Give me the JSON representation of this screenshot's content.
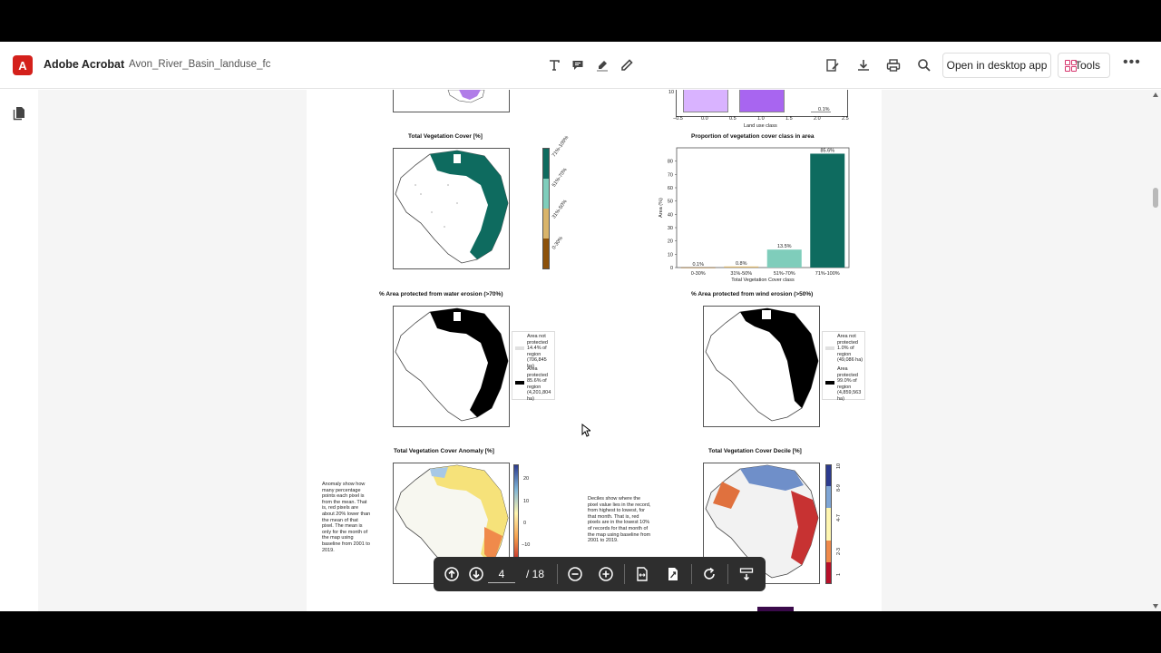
{
  "app": {
    "name": "Adobe Acrobat",
    "logo_letter": "A",
    "file_name": "Avon_River_Basin_landuse_fc",
    "open_button": "Open in desktop app",
    "tools_button": "Tools",
    "more_glyph": "•••",
    "accent": "#d4201b"
  },
  "toolbar_icons": [
    "text-icon",
    "comment-icon",
    "highlight-icon",
    "draw-icon",
    "sign-icon",
    "download-icon",
    "print-icon",
    "search-icon"
  ],
  "document": {
    "top_axis": {
      "ticks": [
        "−0.5",
        "0.0",
        "0.5",
        "1.0",
        "1.5",
        "2.0",
        "2.5"
      ],
      "xlabel": "Land use class",
      "ytick": "10",
      "bar_label": "0.1%"
    },
    "veg_cover": {
      "title": "Total Vegetation Cover [%]",
      "legend": [
        "71%-100%",
        "51%-70%",
        "31%-50%",
        "0-30%"
      ],
      "legend_colors": [
        "#0e6b5f",
        "#7fcdbb",
        "#d9b46a",
        "#8c510a"
      ]
    },
    "proportion_chart": {
      "title": "Proportion of vegetation cover class in area",
      "ylabel": "Area (%)",
      "xlabel": "Total Vegetation Cover class"
    },
    "water_erosion": {
      "title": "% Area protected from water erosion (>70%)",
      "legend_not": "Area not protected 14.4% of region (706,845 ha)",
      "legend_yes": "Area protected 85.6% of region (4,201,804 ha)"
    },
    "wind_erosion": {
      "title": "% Area protected from wind erosion (>50%)",
      "legend_not": "Area not protected 1.0% of region (49,086 ha)",
      "legend_yes": "Area protected 99.0% of region (4,859,563 ha)"
    },
    "anomaly": {
      "title": "Total Vegetation Cover Anomaly [%]",
      "note": "Anomaly show how many percentage points each pixel is from the mean. That is, red pixels are about 20% lower than the mean of that pixel. The mean is only for the month of the map using baseline from 2001 to 2019.",
      "cbar_ticks": [
        "20",
        "10",
        "0",
        "−10"
      ]
    },
    "decile": {
      "title": "Total Vegetation Cover Decile [%]",
      "note": "Deciles show where the pixel value lies in the record, from highest to lowest, for that month. That is, red pixels are in the lowest 10% of records for that month of the map using baseline from 2001 to 2019.",
      "cbar_ticks": [
        "10",
        "8-9",
        "4-7",
        "2-3",
        "1"
      ]
    }
  },
  "chart_data": {
    "type": "bar",
    "title": "Proportion of vegetation cover class in area",
    "xlabel": "Total Vegetation Cover class",
    "ylabel": "Area (%)",
    "categories": [
      "0-30%",
      "31%-50%",
      "51%-70%",
      "71%-100%"
    ],
    "values": [
      0.1,
      0.8,
      13.5,
      85.6
    ],
    "labels": [
      "0.1%",
      "0.8%",
      "13.5%",
      "85.6%"
    ],
    "colors": [
      "#8c510a",
      "#d9b46a",
      "#7fcdbb",
      "#0e6b5f"
    ],
    "ylim": [
      0,
      90
    ],
    "yticks": [
      0,
      10,
      20,
      30,
      40,
      50,
      60,
      70,
      80
    ]
  },
  "navigation": {
    "current_page": "4",
    "total_pages": "/ 18"
  }
}
